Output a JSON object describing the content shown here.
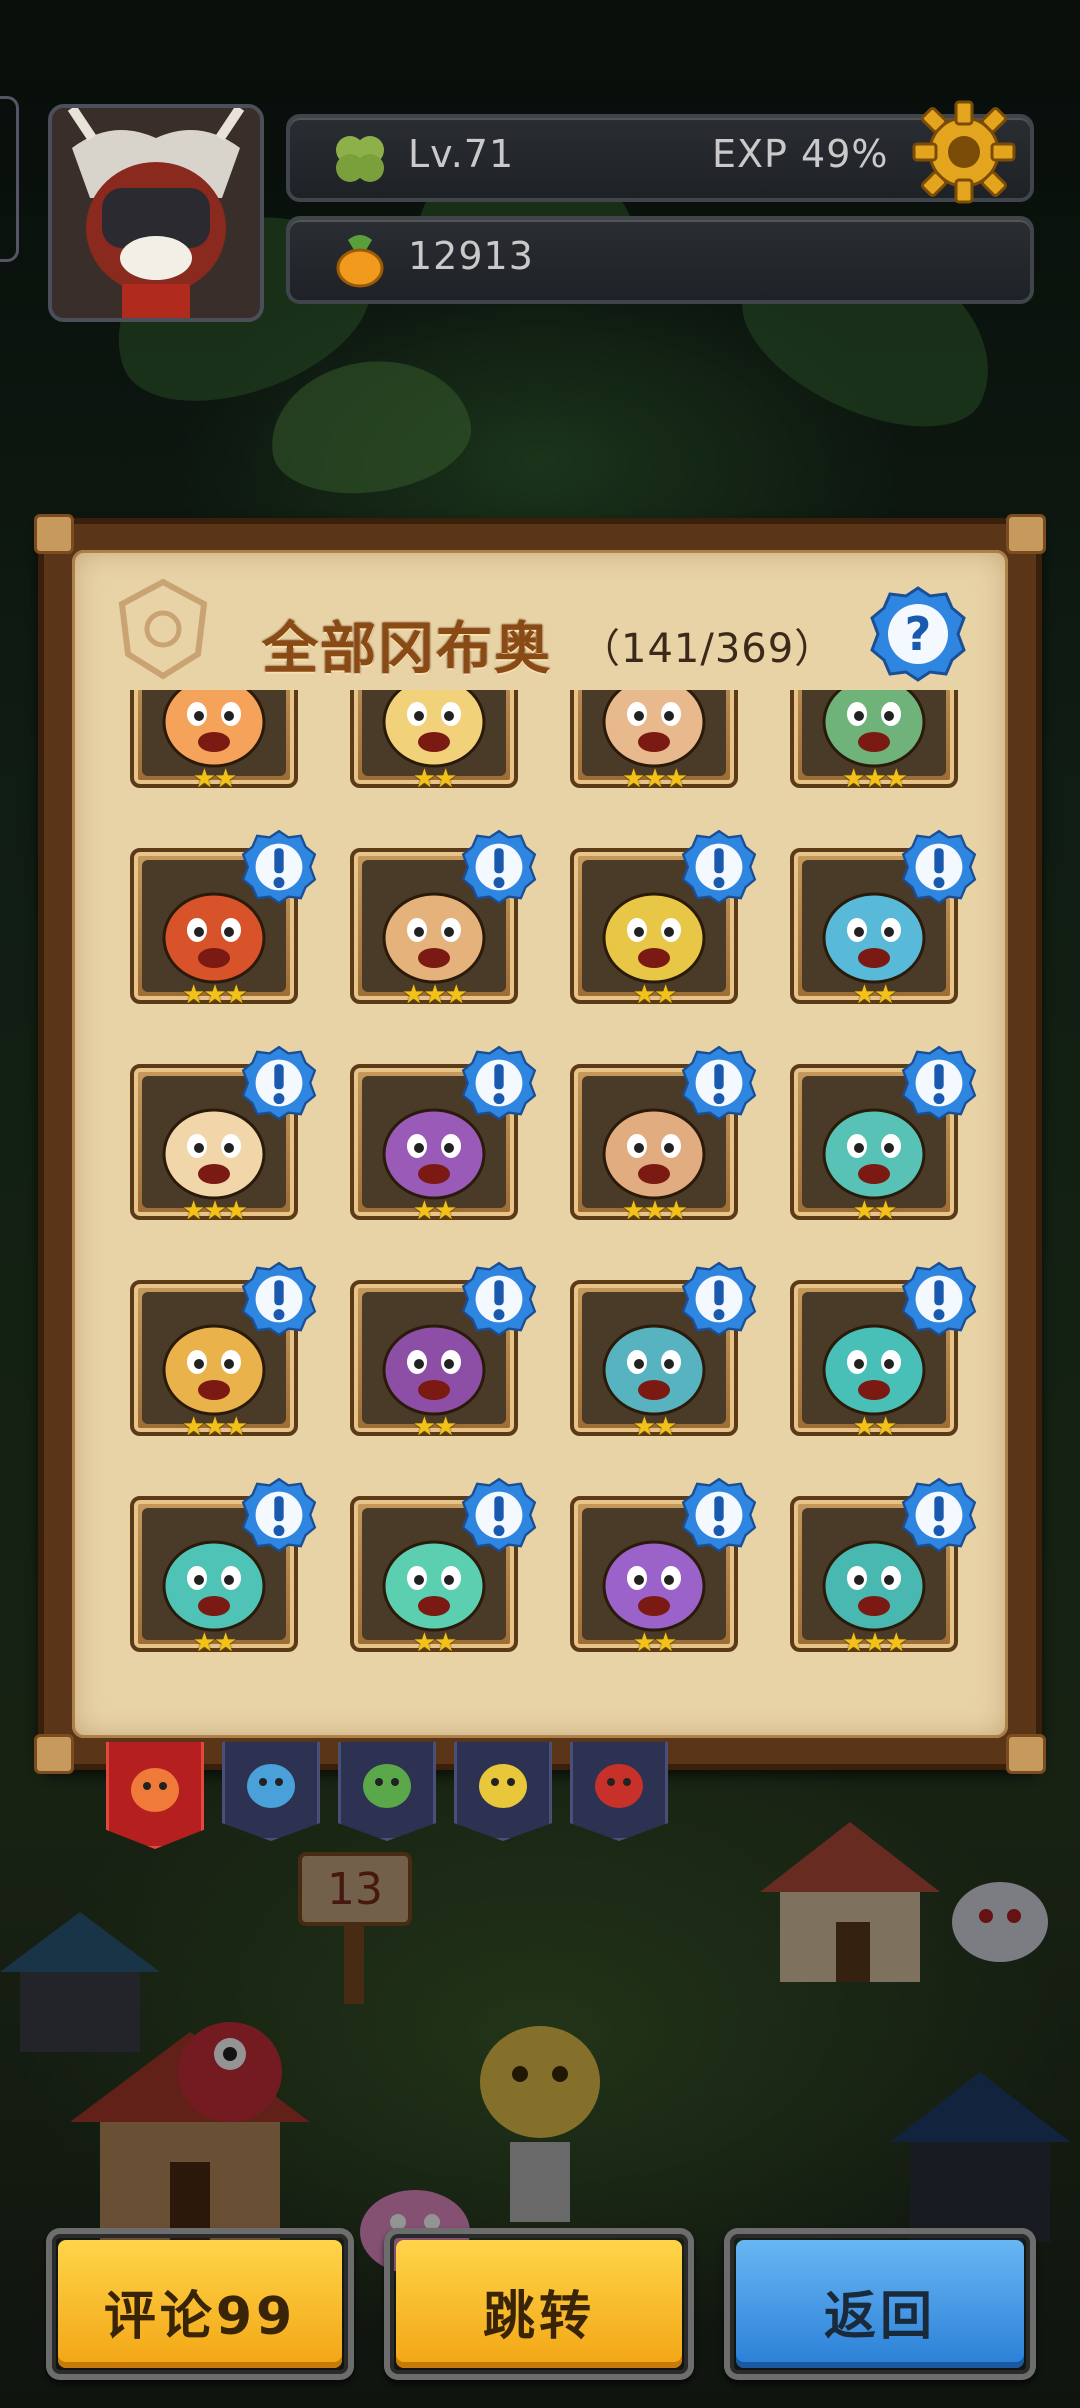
{
  "hud": {
    "level": "Lv.71",
    "exp": "EXP 49%",
    "currency": "12913"
  },
  "collection": {
    "title": "全部冈布奥",
    "count": "（141/369）",
    "help_icon": "question-icon"
  },
  "rows": [
    {
      "cells": [
        {
          "stars": "★★",
          "color": "#f5a25a",
          "badge": false
        },
        {
          "stars": "★★",
          "color": "#f1d27a",
          "badge": false
        },
        {
          "stars": "★★★",
          "color": "#e7b98c",
          "badge": false
        },
        {
          "stars": "★★★",
          "color": "#6fb27a",
          "badge": false
        }
      ]
    },
    {
      "cells": [
        {
          "stars": "★★★",
          "color": "#d8532a",
          "badge": true
        },
        {
          "stars": "★★★",
          "color": "#e4b27a",
          "badge": true
        },
        {
          "stars": "★★",
          "color": "#e8c646",
          "badge": true
        },
        {
          "stars": "★★",
          "color": "#58b9d9",
          "badge": true
        }
      ]
    },
    {
      "cells": [
        {
          "stars": "★★★",
          "color": "#f0d6a8",
          "badge": true
        },
        {
          "stars": "★★",
          "color": "#9a5ab8",
          "badge": true
        },
        {
          "stars": "★★★",
          "color": "#e1ad80",
          "badge": true
        },
        {
          "stars": "★★",
          "color": "#58c2b6",
          "badge": true
        }
      ]
    },
    {
      "cells": [
        {
          "stars": "★★★",
          "color": "#e9b24a",
          "badge": true
        },
        {
          "stars": "★★",
          "color": "#8d4ea6",
          "badge": true
        },
        {
          "stars": "★★",
          "color": "#58b3c0",
          "badge": true
        },
        {
          "stars": "★★",
          "color": "#48c0b8",
          "badge": true
        }
      ]
    },
    {
      "cells": [
        {
          "stars": "★★",
          "color": "#4fc3b6",
          "badge": true
        },
        {
          "stars": "★★",
          "color": "#5ccfb0",
          "badge": true
        },
        {
          "stars": "★★",
          "color": "#9b63c9",
          "badge": true
        },
        {
          "stars": "★★★",
          "color": "#48b8b0",
          "badge": true
        }
      ]
    }
  ],
  "tabs": [
    {
      "icon": "all-heroes-icon",
      "active": true
    },
    {
      "icon": "blue-ghost-icon",
      "active": false
    },
    {
      "icon": "green-leaf-icon",
      "active": false
    },
    {
      "icon": "yellow-star-icon",
      "active": false
    },
    {
      "icon": "red-demon-icon",
      "active": false
    }
  ],
  "buttons": {
    "comment": "评论99",
    "jump": "跳转",
    "back": "返回"
  },
  "scene": {
    "signpost": "13"
  }
}
